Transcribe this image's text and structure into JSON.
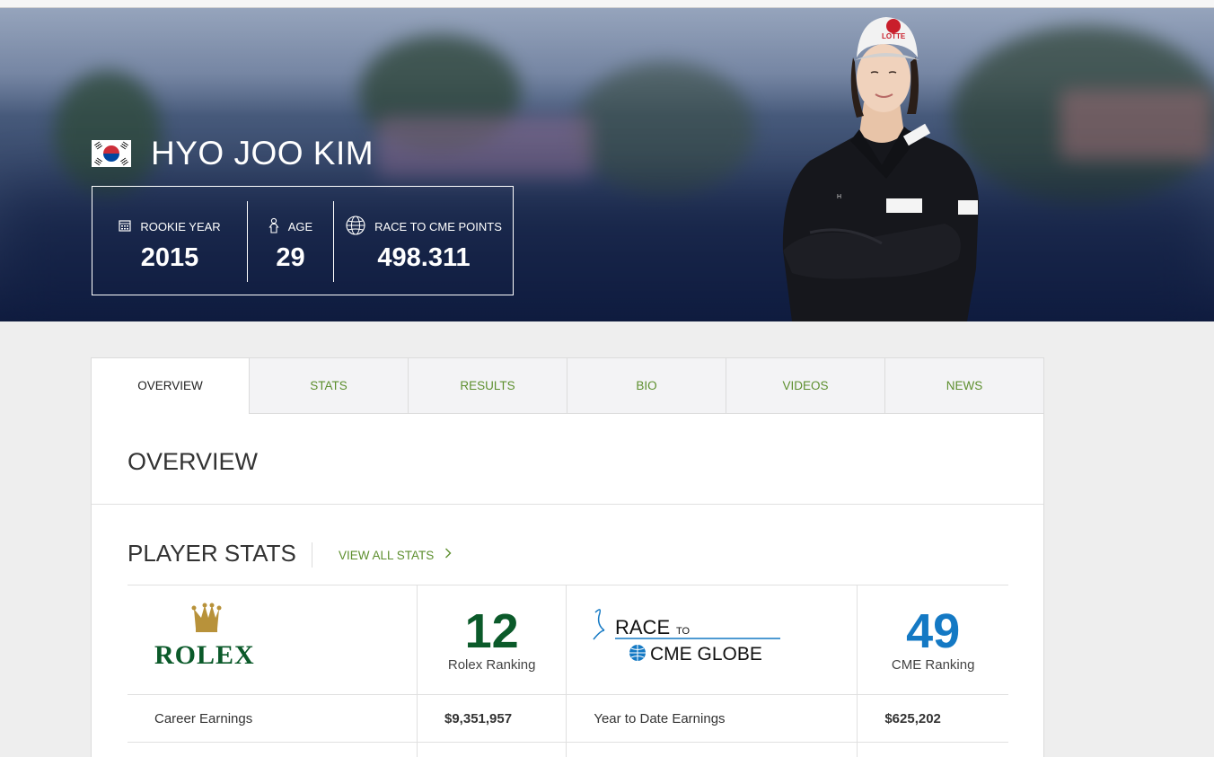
{
  "player": {
    "name": "HYO JOO KIM",
    "stats": [
      {
        "label": "ROOKIE YEAR",
        "value": "2015",
        "icon": "calendar-icon"
      },
      {
        "label": "AGE",
        "value": "29",
        "icon": "person-icon"
      },
      {
        "label": "RACE TO CME POINTS",
        "value": "498.311",
        "icon": "globe-icon"
      }
    ]
  },
  "tabs": [
    "OVERVIEW",
    "STATS",
    "RESULTS",
    "BIO",
    "VIDEOS",
    "NEWS"
  ],
  "overview_title": "OVERVIEW",
  "player_stats": {
    "title": "PLAYER STATS",
    "view_all": "VIEW ALL STATS",
    "rolex": {
      "logo_text": "ROLEX",
      "rank": "12",
      "rank_label": "Rolex Ranking",
      "color": "#0b5a2a"
    },
    "cme": {
      "logo_line1": "RACE",
      "logo_to": "TO",
      "logo_line2": "CME GLOBE",
      "rank": "49",
      "rank_label": "CME Ranking",
      "color": "#1479c4"
    },
    "rows": [
      {
        "label1": "Career Earnings",
        "value1": "$9,351,957",
        "label2": "Year to Date Earnings",
        "value2": "$625,202"
      }
    ]
  },
  "colors": {
    "accent_green": "#5d8f2e",
    "hero_dark": "#101c3f"
  }
}
